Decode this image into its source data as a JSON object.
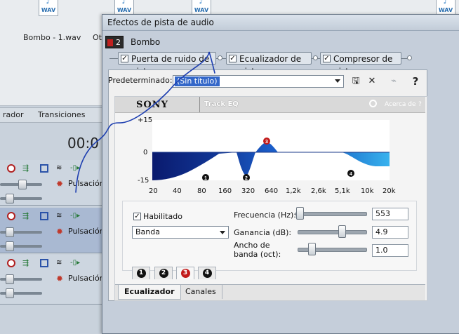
{
  "background": {
    "media": [
      {
        "icon": "WAV",
        "label": "Bombo - 1.wav"
      },
      {
        "icon": "WAV",
        "label": "Ot"
      },
      {
        "icon": "WAV",
        "label": ""
      },
      {
        "icon": "WAV",
        "label": ""
      }
    ],
    "tabs": [
      "rador",
      "Transiciones"
    ],
    "timecode": "00:0",
    "tracks": [
      {
        "label": "Pulsación"
      },
      {
        "label": "Pulsación"
      },
      {
        "label": "Pulsación"
      }
    ]
  },
  "dialog": {
    "title": "Efectos de pista de audio",
    "chain_number": "2",
    "chain_name": "Bombo",
    "effects": [
      {
        "label": "Puerta de ruido de pista",
        "checked": true
      },
      {
        "label": "Ecualizador de pista",
        "checked": true
      },
      {
        "label": "Compresor de pista",
        "checked": true
      }
    ],
    "preset_label": "Predeterminado:",
    "preset_value": "(Sin título)",
    "plugin_header": {
      "brand": "SONY",
      "title": "Track EQ",
      "about": "Acerca de",
      "help": "?"
    },
    "graph": {
      "y_labels": [
        "+15",
        "0",
        "-15"
      ],
      "x_labels": [
        "20",
        "40",
        "80",
        "160",
        "320",
        "640",
        "1,2k",
        "2,6k",
        "5,1k",
        "10k",
        "20k"
      ],
      "band_markers": [
        "1",
        "2",
        "3",
        "4"
      ]
    },
    "controls": {
      "enabled_label": "Habilitado",
      "enabled": true,
      "band_type": "Banda",
      "frequency_label": "Frecuencia (Hz):",
      "frequency_value": "553",
      "gain_label": "Ganancia (dB):",
      "gain_value": "4.9",
      "bandwidth_label_1": "Ancho de",
      "bandwidth_label_2": "banda (oct):",
      "bandwidth_value": "1.0"
    },
    "band_tabs": [
      {
        "label": "1",
        "active": false
      },
      {
        "label": "2",
        "active": false
      },
      {
        "label": "3",
        "active": true
      },
      {
        "label": "4",
        "active": false
      }
    ],
    "bottom_tabs": [
      {
        "label": "Ecualizador",
        "active": true
      },
      {
        "label": "Canales",
        "active": false
      }
    ]
  },
  "colors": {
    "eq_dark": "#0a1f7a",
    "eq_light": "#2ea8e8",
    "accent_red": "#c21b1b",
    "selection": "#3367c9"
  }
}
